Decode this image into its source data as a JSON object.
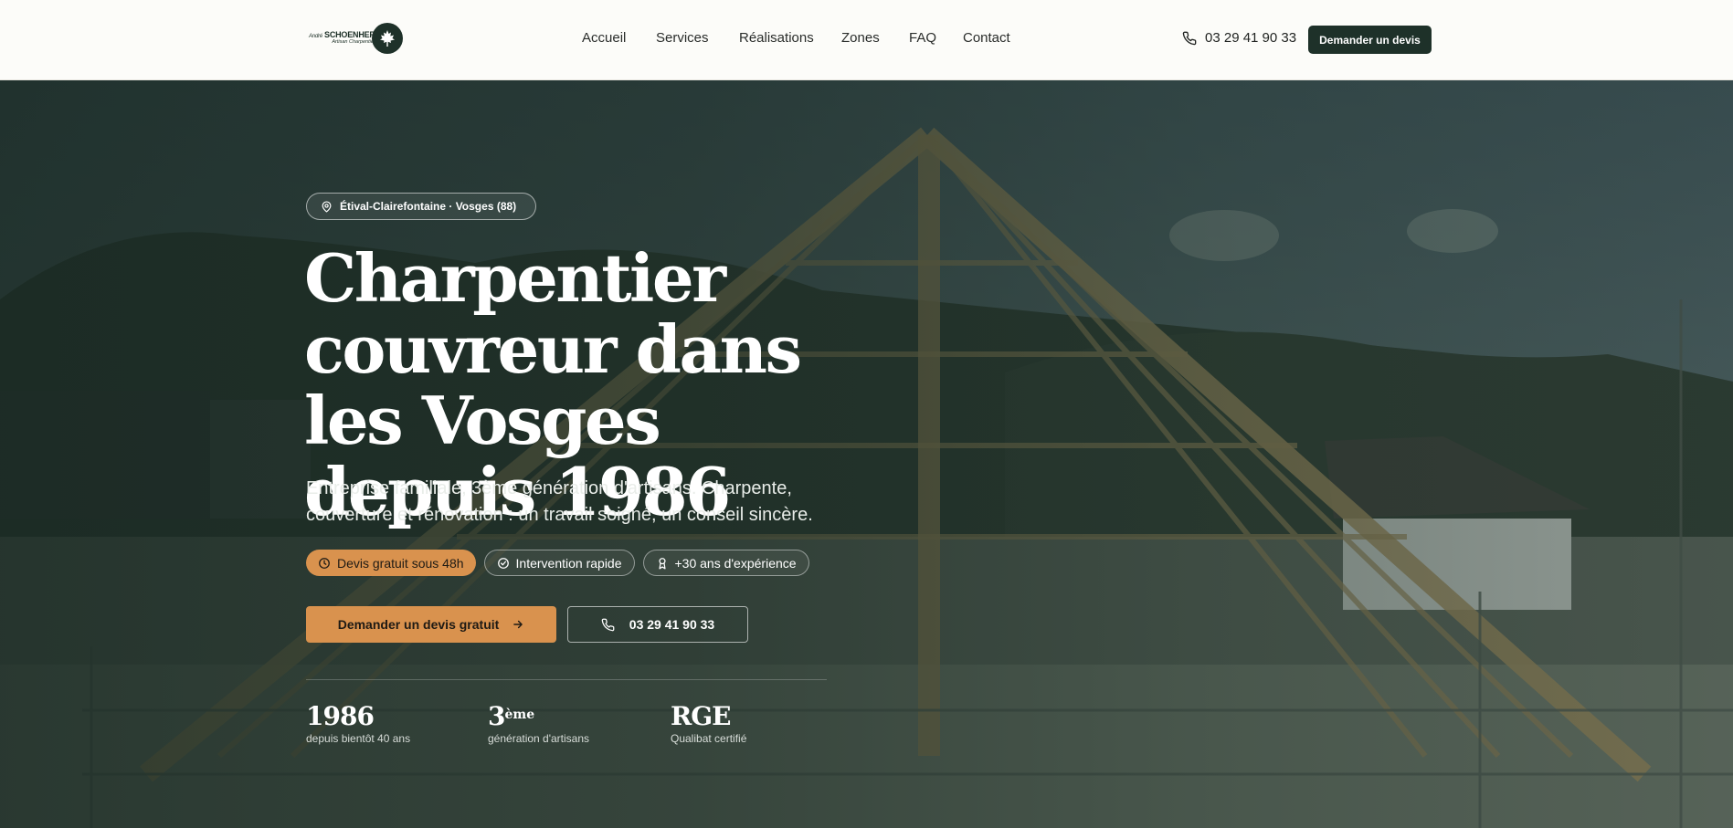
{
  "header": {
    "logo": {
      "name_prefix": "André",
      "name": "SCHOENHER",
      "subtitle": "Artisan Charpentier"
    },
    "nav": [
      {
        "label": "Accueil"
      },
      {
        "label": "Services"
      },
      {
        "label": "Réalisations"
      },
      {
        "label": "Zones"
      },
      {
        "label": "FAQ"
      },
      {
        "label": "Contact"
      }
    ],
    "phone": "03 29 41 90 33",
    "cta_label": "Demander un devis"
  },
  "hero": {
    "location": "Étival-Clairefontaine · Vosges (88)",
    "title": "Charpentier couvreur dans les Vosges depuis 1986",
    "subtitle": "Entreprise familiale, 3ème génération d'artisans. Charpente, couverture et rénovation : un travail soigné, un conseil sincère.",
    "badges": [
      {
        "label": "Devis gratuit sous 48h",
        "icon": "clock-icon"
      },
      {
        "label": "Intervention rapide",
        "icon": "check-circle-icon"
      },
      {
        "label": "+30 ans d'expérience",
        "icon": "award-icon"
      }
    ],
    "cta_primary": "Demander un devis gratuit",
    "cta_secondary": "03 29 41 90 33",
    "stats": [
      {
        "value": "1986",
        "label": "depuis bientôt 40 ans"
      },
      {
        "value": "3",
        "value_sup": "ème",
        "label": "génération d'artisans"
      },
      {
        "value": "RGE",
        "label": "Qualibat certifié"
      }
    ]
  },
  "colors": {
    "brand_dark": "#1e3129",
    "accent": "#d9924e",
    "background": "#fcfcf9"
  }
}
